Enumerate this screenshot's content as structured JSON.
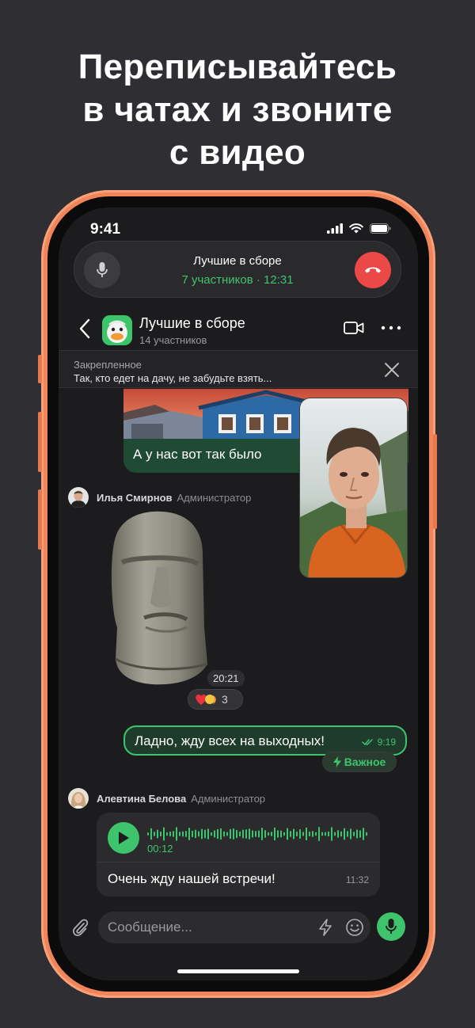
{
  "headline": {
    "line1": "Переписывайтесь",
    "line2": "в чатах и звоните",
    "line3": "с видео"
  },
  "status_bar": {
    "time": "9:41"
  },
  "call": {
    "title": "Лучшие в сборе",
    "subtitle": "7 участников · 12:31"
  },
  "chat": {
    "name": "Лучшие в сборе",
    "members": "14 участников"
  },
  "pinned": {
    "label": "Закрепленное",
    "text": "Так, кто едет на дачу, не забудьте взять..."
  },
  "messages": {
    "photo_caption": "А у нас вот так было",
    "sender1": {
      "name": "Илья Смирнов",
      "role": "Администратор"
    },
    "sticker_time": "20:21",
    "reaction_count": "3",
    "outgoing": {
      "text": "Ладно, жду всех на выходных!",
      "time": "9:19",
      "tag": "Важное"
    },
    "sender2": {
      "name": "Алевтина Белова",
      "role": "Администратор"
    },
    "voice": {
      "duration": "00:12",
      "text": "Очень жду нашей встречи!",
      "time": "11:32"
    }
  },
  "composer": {
    "placeholder": "Сообщение..."
  },
  "colors": {
    "accent": "#3ec46d",
    "end_call": "#eb4848",
    "phone_frame": "#f0855a",
    "background": "#2f2f33"
  }
}
